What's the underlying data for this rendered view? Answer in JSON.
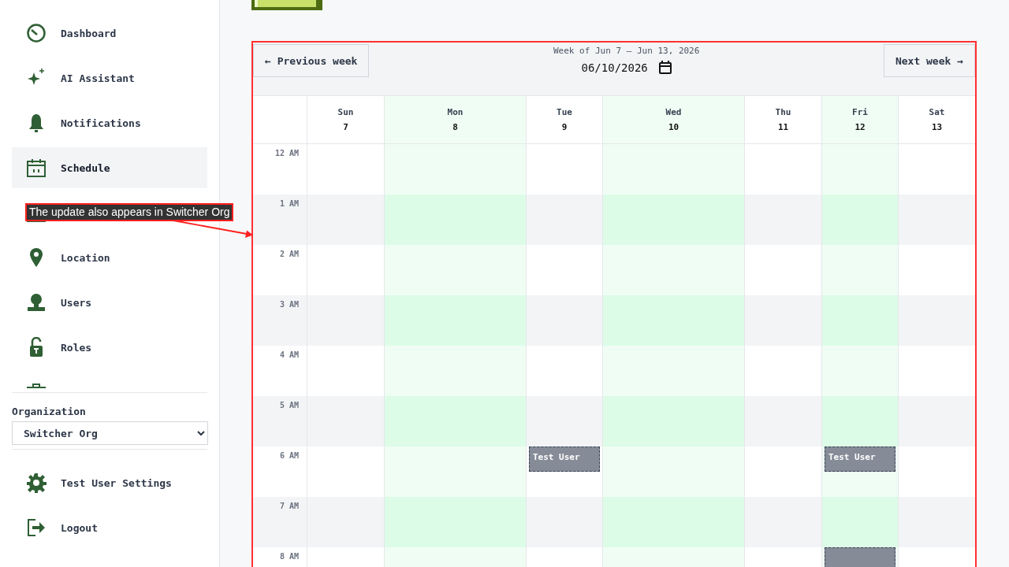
{
  "sidebar": {
    "nav_items": [
      {
        "label": "Dashboard",
        "selected": false
      },
      {
        "label": "AI Assistant",
        "selected": false
      },
      {
        "label": "Notifications",
        "selected": false
      },
      {
        "label": "Schedule",
        "selected": true
      },
      {
        "selected": false
      },
      {
        "label": "Location",
        "selected": false
      },
      {
        "label": "Users",
        "selected": false
      },
      {
        "label": "Roles",
        "selected": false
      },
      {
        "selected": false
      }
    ],
    "organization": {
      "label": "Organization",
      "value": "Switcher Org"
    },
    "footer_items": [
      {
        "label": "Test User Settings"
      },
      {
        "label": "Logout"
      }
    ]
  },
  "calendar": {
    "previous_button": "← Previous week",
    "week_range": "Week of Jun 7 – Jun 13, 2026",
    "date_value": "06/10/2026",
    "next_button": "Next week →",
    "days": [
      {
        "name": "Sun",
        "date": "7",
        "highlighted": false
      },
      {
        "name": "Mon",
        "date": "8",
        "highlighted": true
      },
      {
        "name": "Tue",
        "date": "9",
        "highlighted": false
      },
      {
        "name": "Wed",
        "date": "10",
        "highlighted": true
      },
      {
        "name": "Thu",
        "date": "11",
        "highlighted": false
      },
      {
        "name": "Fri",
        "date": "12",
        "highlighted": true
      },
      {
        "name": "Sat",
        "date": "13",
        "highlighted": false
      }
    ],
    "rows": [
      {
        "time": "12 AM",
        "slots": [
          {
            "booked": false
          },
          {
            "booked": false
          },
          {
            "booked": false
          },
          {
            "booked": false
          },
          {
            "booked": false
          },
          {
            "booked": false
          },
          {
            "booked": false
          }
        ]
      },
      {
        "time": "1 AM",
        "slots": [
          {
            "booked": false
          },
          {
            "booked": false
          },
          {
            "booked": false
          },
          {
            "booked": false
          },
          {
            "booked": false
          },
          {
            "booked": false
          },
          {
            "booked": false
          }
        ]
      },
      {
        "time": "2 AM",
        "slots": [
          {
            "booked": false
          },
          {
            "booked": false
          },
          {
            "booked": false
          },
          {
            "booked": false
          },
          {
            "booked": false
          },
          {
            "booked": false
          },
          {
            "booked": false
          }
        ]
      },
      {
        "time": "3 AM",
        "slots": [
          {
            "booked": false
          },
          {
            "booked": false
          },
          {
            "booked": false
          },
          {
            "booked": false
          },
          {
            "booked": false
          },
          {
            "booked": false
          },
          {
            "booked": false
          }
        ]
      },
      {
        "time": "4 AM",
        "slots": [
          {
            "booked": false
          },
          {
            "booked": false
          },
          {
            "booked": false
          },
          {
            "booked": false
          },
          {
            "booked": false
          },
          {
            "booked": false
          },
          {
            "booked": false
          }
        ]
      },
      {
        "time": "5 AM",
        "slots": [
          {
            "booked": false
          },
          {
            "booked": false
          },
          {
            "booked": false
          },
          {
            "booked": false
          },
          {
            "booked": false
          },
          {
            "booked": false
          },
          {
            "booked": false
          }
        ]
      },
      {
        "time": "6 AM",
        "slots": [
          {
            "booked": false
          },
          {
            "booked": false
          },
          {
            "booked": true,
            "label": "Test User"
          },
          {
            "booked": false
          },
          {
            "booked": false
          },
          {
            "booked": true,
            "label": "Test User"
          },
          {
            "booked": false
          }
        ]
      },
      {
        "time": "7 AM",
        "slots": [
          {
            "booked": false
          },
          {
            "booked": false
          },
          {
            "booked": false
          },
          {
            "booked": false
          },
          {
            "booked": false
          },
          {
            "booked": false
          },
          {
            "booked": false
          }
        ]
      },
      {
        "time": "8 AM",
        "slots": [
          {
            "booked": false
          },
          {
            "booked": false
          },
          {
            "booked": false
          },
          {
            "booked": false
          },
          {
            "booked": false
          },
          {
            "booked": true
          },
          {
            "booked": false
          }
        ]
      }
    ]
  },
  "annotation": {
    "text": "The update also appears in Switcher Org"
  }
}
